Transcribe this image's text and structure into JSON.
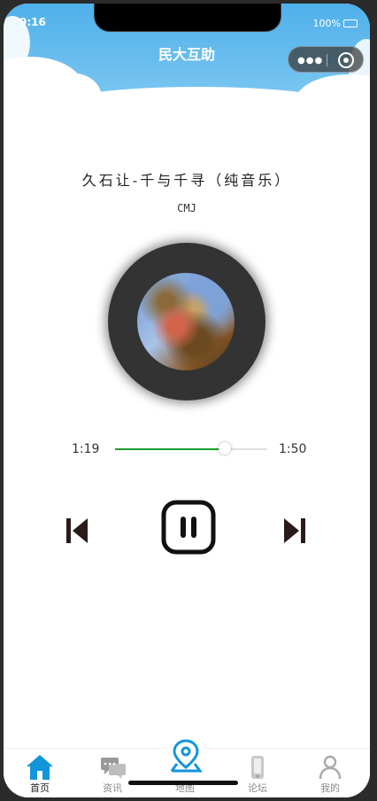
{
  "status": {
    "time": "9:16",
    "battery": "100%"
  },
  "header": {
    "title": "民大互助"
  },
  "player": {
    "song_title": "久石让-千与千寻（纯音乐）",
    "artist": "CMJ",
    "current_time": "1:19",
    "total_time": "1:50",
    "progress": 0.72,
    "state": "playing"
  },
  "tabs": [
    {
      "label": "首页",
      "icon": "home-icon",
      "active": true
    },
    {
      "label": "资讯",
      "icon": "chat-icon",
      "active": false
    },
    {
      "label": "地图",
      "icon": "map-pin-icon",
      "active": false
    },
    {
      "label": "论坛",
      "icon": "phone-icon",
      "active": false
    },
    {
      "label": "我的",
      "icon": "user-icon",
      "active": false
    }
  ],
  "colors": {
    "header_blue": "#5ab8ec",
    "progress_green": "#1a9e2a",
    "tab_active_blue": "#1296db"
  }
}
